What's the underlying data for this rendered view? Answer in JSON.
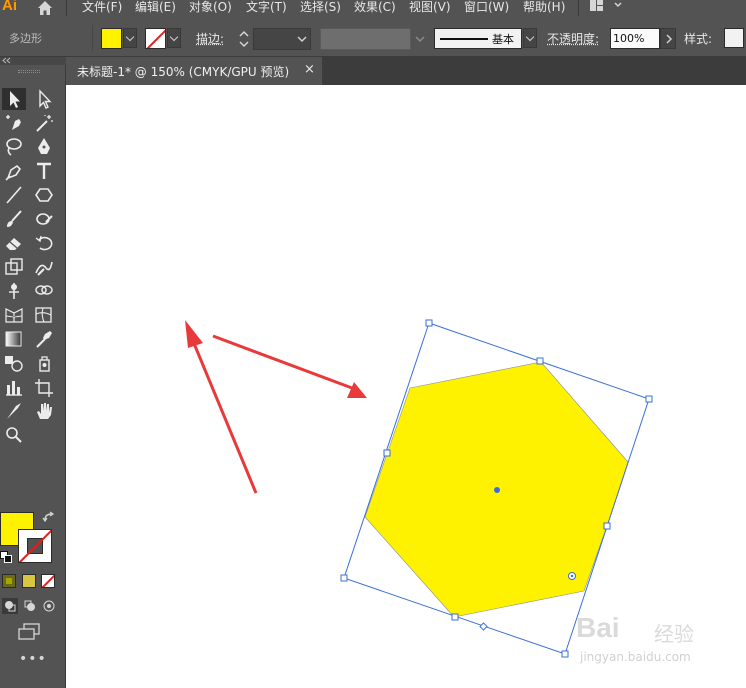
{
  "app": {
    "logo": "Ai"
  },
  "menu": [
    "文件(F)",
    "编辑(E)",
    "对象(O)",
    "文字(T)",
    "选择(S)",
    "效果(C)",
    "视图(V)",
    "窗口(W)",
    "帮助(H)"
  ],
  "control_bar": {
    "shape_label": "多边形",
    "fill_color": "#fff200",
    "stroke_label": "描边",
    "stroke_colon": ":",
    "profile_label": "基本",
    "opacity_label": "不透明度",
    "opacity_colon": ":",
    "opacity_value": "100%",
    "style_label": "样式",
    "style_colon": ":"
  },
  "document_tab": {
    "title": "未标题-1* @ 150% (CMYK/GPU 预览)",
    "close": "×"
  },
  "toolbar": {
    "more": "•••",
    "fill_color": "#fff200",
    "stroke_color": "none"
  },
  "canvas": {
    "shape_fill": "#fff200",
    "selection_color": "#3a6fd8",
    "arrow_color": "#e83a3a"
  },
  "watermark": {
    "brand": "Bai",
    "brand2": "经验",
    "url": "jingyan.baidu.com"
  }
}
